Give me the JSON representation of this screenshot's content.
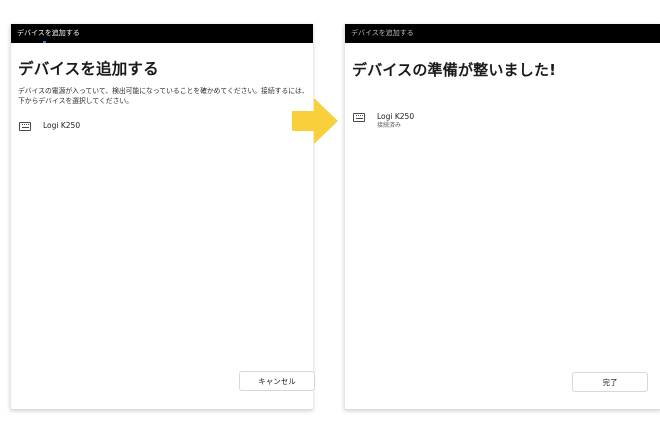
{
  "left_dialog": {
    "titlebar": "デバイスを追加する",
    "heading": "デバイスを追加する",
    "description": "デバイスの電源が入っていて、検出可能になっていることを確かめてください。接続するには、下からデバイスを選択してください。",
    "device_name": "Logi K250",
    "cancel_label": "キャンセル"
  },
  "right_dialog": {
    "titlebar": "デバイスを追加する",
    "heading": "デバイスの準備が整いました!",
    "device_name": "Logi K250",
    "device_status": "接続済み",
    "done_label": "完了"
  },
  "icons": {
    "device": "keyboard-icon",
    "transition": "arrow-right-icon"
  },
  "colors": {
    "titlebar": "#000000",
    "arrow": "#f9cf3c",
    "accent": "#2f7bd8"
  }
}
